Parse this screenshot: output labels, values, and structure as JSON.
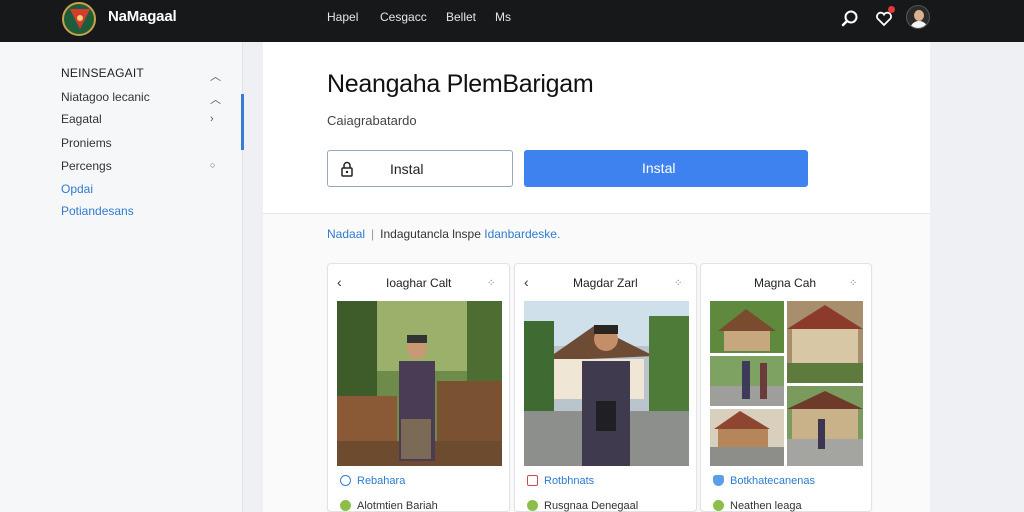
{
  "header": {
    "brand": "NaMagaal",
    "nav": [
      "Hapel",
      "Cesgacc",
      "Bellet",
      "Ms"
    ],
    "icons": [
      "search-icon",
      "heart-icon",
      "avatar"
    ]
  },
  "sidebar": {
    "heading": "NEINSEAGAIT",
    "items": [
      {
        "label": "Niatagoo lecanic"
      },
      {
        "label": "Eagatal"
      },
      {
        "label": "Proniems"
      },
      {
        "label": "Percengs"
      },
      {
        "label": "Opdai"
      },
      {
        "label": "Potiandesans"
      }
    ]
  },
  "main": {
    "title": "Neangaha PlemBarigam",
    "subtitle": "Caiagrabatardo",
    "buttons": {
      "outline_label": "Instal",
      "primary_label": "Instal"
    },
    "breadcrumb": {
      "link": "Nadaal",
      "separator": "|",
      "text": "Indagutancla lnspe",
      "link2": "Idanbardeske."
    },
    "cards": [
      {
        "title": "Ioaghar Calt",
        "meta1": "Rebahara",
        "meta2": "Alotmtien Bariah"
      },
      {
        "title": "Magdar Zarl",
        "meta1": "Rotbhnats",
        "meta2": "Rusgnaa Denegaal"
      },
      {
        "title": "Magna Cah",
        "meta1": "Botkhatecanenas",
        "meta2": "Neathen leaga"
      }
    ]
  },
  "colors": {
    "primary": "#3d82ee",
    "link": "#2f7bd0",
    "topbar": "#17181a"
  }
}
